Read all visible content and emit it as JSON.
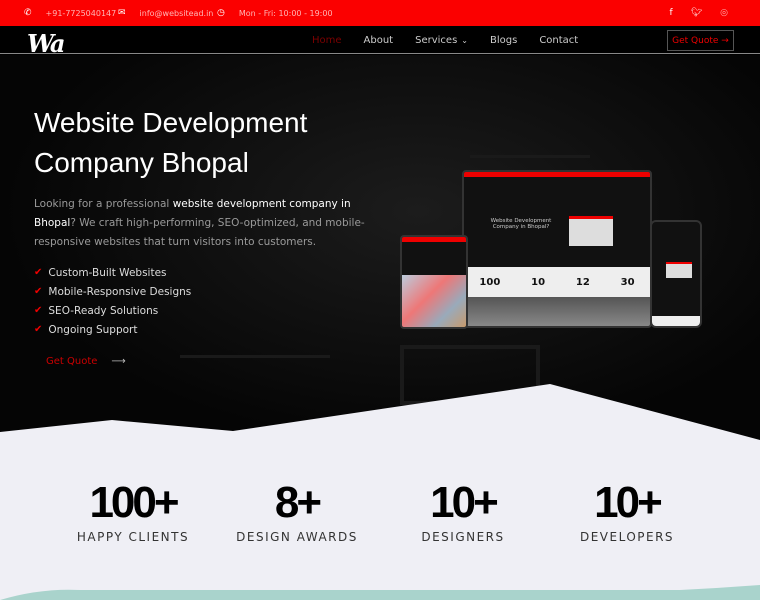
{
  "topbar": {
    "phone": "+91-7725040147",
    "email": "info@websitead.in",
    "hours": "Mon - Fri: 10:00 - 19:00",
    "social": [
      "facebook-icon",
      "twitter-icon",
      "instagram-icon"
    ]
  },
  "nav": {
    "logo": "Wa",
    "items": [
      "Home",
      "About",
      "Services",
      "Blogs",
      "Contact"
    ],
    "cta": "Get Quote"
  },
  "hero": {
    "title_line1": "Website Development",
    "title_line2": "Company Bhopal",
    "desc_pre": "Looking for a professional ",
    "desc_bold": "website development company in Bhopal",
    "desc_post": "? We craft high-performing, SEO-optimized, and mobile-responsive websites that turn visitors into customers.",
    "features": [
      "Custom-Built Websites",
      "Mobile-Responsive Designs",
      "SEO-Ready Solutions",
      "Ongoing Support"
    ],
    "cta": "Get Quote",
    "mockup": {
      "title": "Website Development Company in Bhopal?",
      "numbers": [
        "100",
        "10",
        "12",
        "30"
      ]
    }
  },
  "stats": [
    {
      "value": "100+",
      "label": "HAPPY CLIENTS"
    },
    {
      "value": "8+",
      "label": "DESIGN AWARDS"
    },
    {
      "value": "10+",
      "label": "DESIGNERS"
    },
    {
      "value": "10+",
      "label": "DEVELOPERS"
    }
  ],
  "colors": {
    "brand": "#fb0000",
    "light": "#efeff5"
  }
}
